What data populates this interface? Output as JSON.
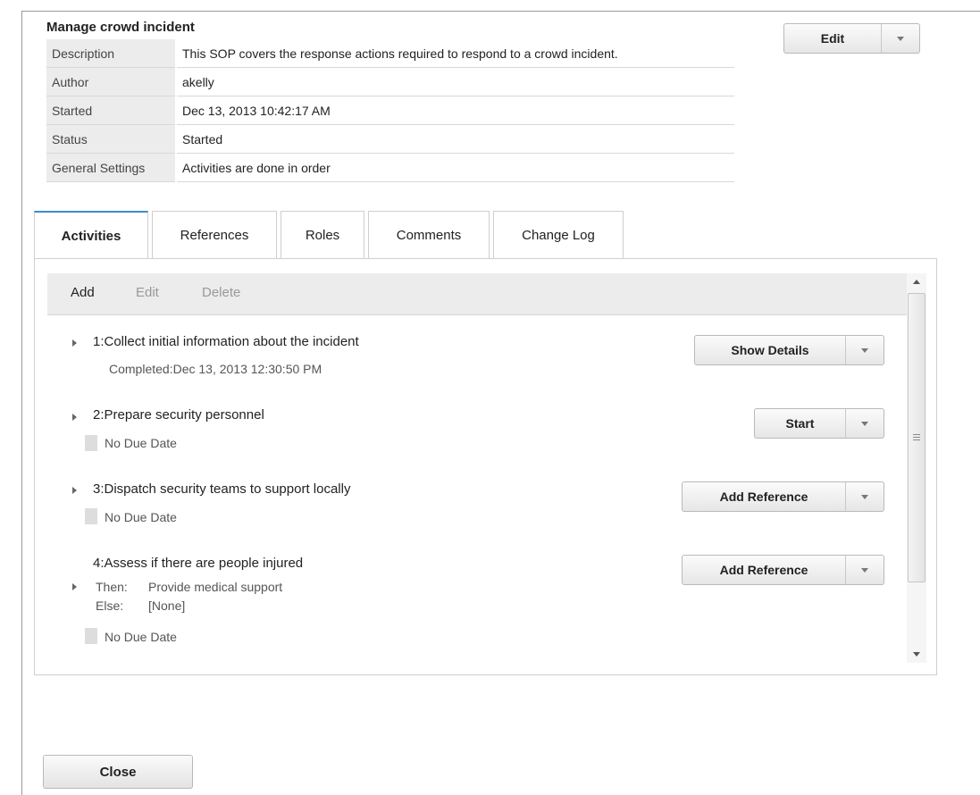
{
  "header": {
    "title": "Manage crowd incident",
    "edit_label": "Edit"
  },
  "properties": [
    {
      "key": "Description",
      "value": "This SOP covers the response actions required to respond to a crowd incident."
    },
    {
      "key": "Author",
      "value": "akelly"
    },
    {
      "key": "Started",
      "value": "Dec 13, 2013 10:42:17 AM"
    },
    {
      "key": "Status",
      "value": "Started"
    },
    {
      "key": "General Settings",
      "value": "Activities are done in order"
    }
  ],
  "tabs": [
    {
      "label": "Activities",
      "active": true
    },
    {
      "label": "References",
      "active": false
    },
    {
      "label": "Roles",
      "active": false
    },
    {
      "label": "Comments",
      "active": false
    },
    {
      "label": "Change Log",
      "active": false
    }
  ],
  "toolbar": {
    "add": "Add",
    "edit": "Edit",
    "delete": "Delete"
  },
  "activities": [
    {
      "title": "1:Collect initial information about the incident",
      "status": "Completed:Dec 13, 2013 12:30:50 PM",
      "action": "Show Details"
    },
    {
      "title": "2:Prepare security personnel",
      "due": "No Due Date",
      "action": "Start"
    },
    {
      "title": "3:Dispatch security teams to support locally",
      "due": "No Due Date",
      "action": "Add Reference"
    },
    {
      "title": "4:Assess if there are people injured",
      "then_label": "Then:",
      "then_value": "Provide medical support",
      "else_label": "Else:",
      "else_value": "[None]",
      "due": "No Due Date",
      "action": "Add Reference"
    }
  ],
  "footer": {
    "close_label": "Close"
  },
  "colors": {
    "accent": "#3c8dc8",
    "disabled": "#999999"
  }
}
